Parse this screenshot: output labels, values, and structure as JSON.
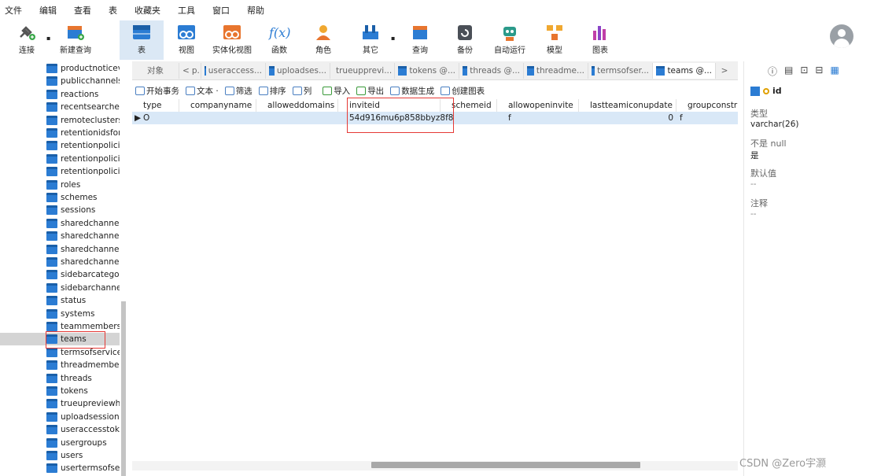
{
  "menubar": {
    "items": [
      "文件",
      "编辑",
      "查看",
      "表",
      "收藏夹",
      "工具",
      "窗口",
      "帮助"
    ]
  },
  "toolbar": {
    "buttons": [
      {
        "label": "连接",
        "icon": "plug-icon"
      },
      {
        "label": "新建查询",
        "icon": "new-query-icon"
      },
      {
        "label": "表",
        "icon": "table-icon"
      },
      {
        "label": "视图",
        "icon": "view-icon"
      },
      {
        "label": "实体化视图",
        "icon": "materialized-view-icon"
      },
      {
        "label": "函数",
        "icon": "function-icon"
      },
      {
        "label": "角色",
        "icon": "user-icon"
      },
      {
        "label": "其它",
        "icon": "tools-icon"
      },
      {
        "label": "查询",
        "icon": "query-icon"
      },
      {
        "label": "备份",
        "icon": "backup-icon"
      },
      {
        "label": "自动运行",
        "icon": "robot-icon"
      },
      {
        "label": "模型",
        "icon": "model-icon"
      },
      {
        "label": "图表",
        "icon": "chart-icon"
      }
    ],
    "active": "表",
    "function_glyph": "f(x)"
  },
  "tree": {
    "items": [
      "productnoticev",
      "publicchannels",
      "reactions",
      "recentsearches",
      "remoteclusters",
      "retentionidsfor",
      "retentionpolicie",
      "retentionpolicie",
      "retentionpolicie",
      "roles",
      "schemes",
      "sessions",
      "sharedchannela",
      "sharedchannelr",
      "sharedchannels",
      "sharedchannelu",
      "sidebarcategor",
      "sidebarchannel",
      "status",
      "systems",
      "teammembers",
      "teams",
      "termsofservice",
      "threadmember",
      "threads",
      "tokens",
      "trueupreviewhi",
      "uploadsessions",
      "useraccesstoke",
      "usergroups",
      "users",
      "usertermsofser"
    ],
    "selected": "teams"
  },
  "tabs": {
    "objects_label": "对象",
    "items": [
      "p...",
      "useraccess...",
      "uploadses...",
      "trueupprevi...",
      "tokens @...",
      "threads @...",
      "threadme...",
      "termsofser...",
      "teams @..."
    ],
    "active": "teams @...",
    "nav_left": "<",
    "nav_right": ">"
  },
  "actions": [
    "开始事务",
    "文本 ·",
    "筛选",
    "排序",
    "列",
    "导入",
    "导出",
    "数据生成",
    "创建图表"
  ],
  "grid": {
    "columns": [
      "type",
      "companyname",
      "alloweddomains",
      "inviteid",
      "schemeid",
      "allowopeninvite",
      "lastteamiconupdate",
      "groupconstr"
    ],
    "rows": [
      {
        "marker": "▶",
        "type": "O",
        "companyname": "",
        "alloweddomains": "",
        "inviteid": "54d916mu6p858bbyz8f8",
        "schemeid": "",
        "allowopeninvite": "f",
        "lastteamiconupdate": "0",
        "groupconstr": "f"
      }
    ]
  },
  "inspector": {
    "field_name": "id",
    "type_label": "类型",
    "type_value": "varchar(26)",
    "notnull_label": "不是 null",
    "notnull_value": "是",
    "default_label": "默认值",
    "default_value": "--",
    "comment_label": "注释",
    "comment_value": "--"
  },
  "watermark": "CSDN @Zero宇灏"
}
